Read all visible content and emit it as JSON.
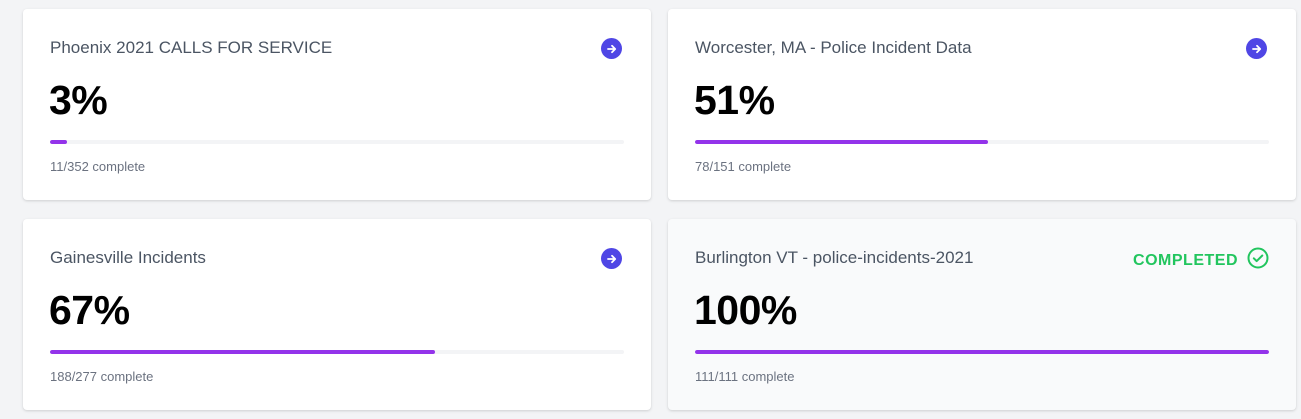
{
  "cards": [
    {
      "title": "Phoenix 2021 CALLS FOR SERVICE",
      "percent": "3%",
      "progress": 0.03,
      "count": "11/352 complete",
      "icon": "arrow-right-circle-icon"
    },
    {
      "title": "Worcester, MA - Police Incident Data",
      "percent": "51%",
      "progress": 0.51,
      "count": "78/151 complete",
      "icon": "arrow-right-circle-icon"
    },
    {
      "title": "Gainesville Incidents",
      "percent": "67%",
      "progress": 0.67,
      "count": "188/277 complete",
      "icon": "arrow-right-circle-icon"
    },
    {
      "title": "Burlington VT - police-incidents-2021",
      "percent": "100%",
      "progress": 1.0,
      "count": "111/111 complete",
      "status": "COMPLETED",
      "icon": "check-circle-icon"
    }
  ],
  "colors": {
    "accent": "#4f46e5",
    "progress": "#9333ea",
    "completed": "#22c55e"
  }
}
